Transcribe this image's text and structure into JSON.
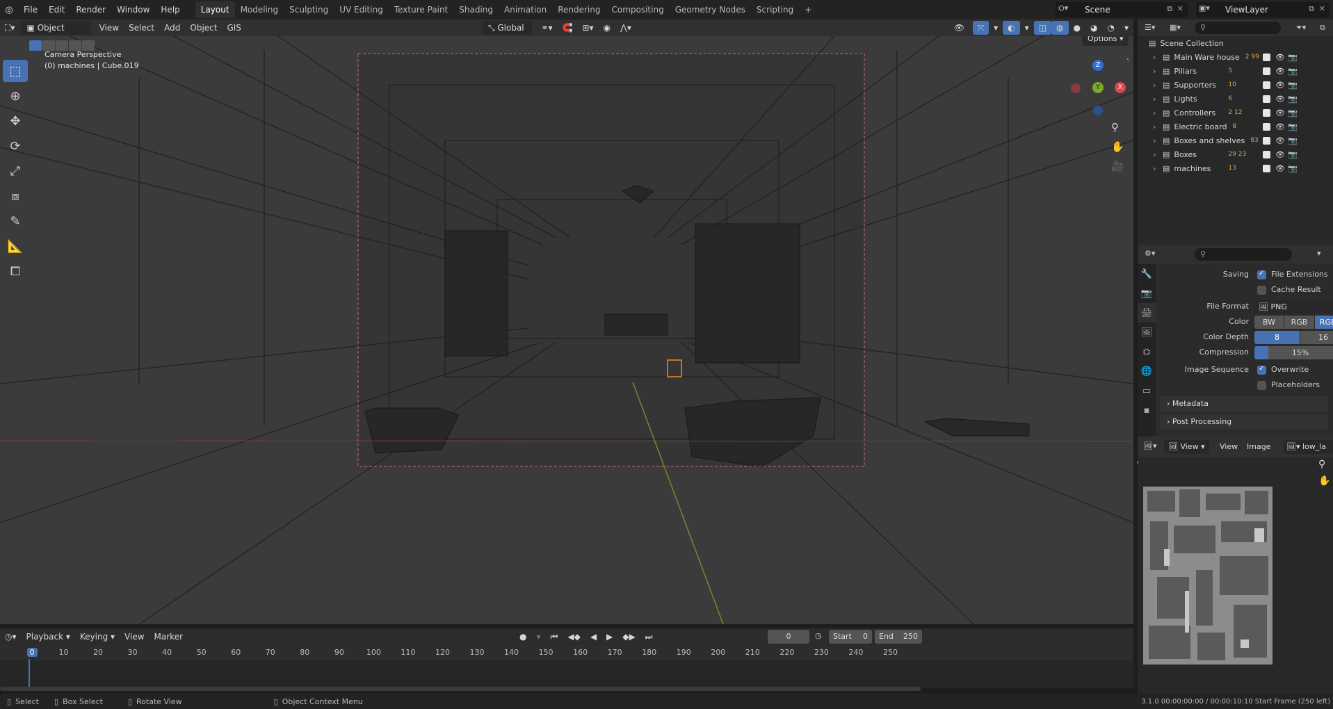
{
  "topbar": {
    "menus": [
      "File",
      "Edit",
      "Render",
      "Window",
      "Help"
    ],
    "workspaces": [
      "Layout",
      "Modeling",
      "Sculpting",
      "UV Editing",
      "Texture Paint",
      "Shading",
      "Animation",
      "Rendering",
      "Compositing",
      "Geometry Nodes",
      "Scripting"
    ],
    "active_workspace": "Layout",
    "add_tab": "+",
    "scene": "Scene",
    "view_layer": "ViewLayer"
  },
  "viewport_header": {
    "mode": "Object Mode",
    "menus": [
      "View",
      "Select",
      "Add",
      "Object",
      "GIS"
    ],
    "orientation": "Global",
    "options": "Options"
  },
  "viewport": {
    "camera_label": "Camera Perspective",
    "object_label": "(0) machines | Cube.019",
    "gizmo_z": "Z",
    "gizmo_y": "Y",
    "gizmo_x": "X"
  },
  "outliner": {
    "root": "Scene Collection",
    "items": [
      {
        "label": "Main Ware house",
        "badges": "2 99"
      },
      {
        "label": "Pillars",
        "badges": "5"
      },
      {
        "label": "Supporters",
        "badges": "10"
      },
      {
        "label": "Lights",
        "badges": "6"
      },
      {
        "label": "Controllers",
        "badges": "2 12"
      },
      {
        "label": "Electric board",
        "badges": "6"
      },
      {
        "label": "Boxes and shelves",
        "badges": "83"
      },
      {
        "label": "Boxes",
        "badges": "29 23"
      },
      {
        "label": "machines",
        "badges": "13"
      }
    ]
  },
  "properties": {
    "saving_label": "Saving",
    "file_extensions": "File Extensions",
    "cache_result": "Cache Result",
    "file_format_label": "File Format",
    "file_format": "PNG",
    "color_label": "Color",
    "color_options": [
      "BW",
      "RGB",
      "RGBA"
    ],
    "color_active": "RGBA",
    "color_depth_label": "Color Depth",
    "color_depth_options": [
      "8",
      "16"
    ],
    "compression_label": "Compression",
    "compression": "15%",
    "compression_fraction": 0.15,
    "image_sequence_label": "Image Sequence",
    "overwrite": "Overwrite",
    "placeholders": "Placeholders",
    "metadata": "Metadata",
    "post_processing": "Post Processing"
  },
  "image_editor": {
    "view_menu": "View",
    "view": "View",
    "image": "Image",
    "image_name": "low_la"
  },
  "timeline": {
    "menus": [
      "Playback",
      "Keying",
      "View",
      "Marker"
    ],
    "current_frame": "0",
    "start_label": "Start",
    "start": "0",
    "end_label": "End",
    "end": "250",
    "ticks": [
      "0",
      "10",
      "20",
      "30",
      "40",
      "50",
      "60",
      "70",
      "80",
      "90",
      "100",
      "110",
      "120",
      "130",
      "140",
      "150",
      "160",
      "170",
      "180",
      "190",
      "200",
      "210",
      "220",
      "230",
      "240",
      "250"
    ]
  },
  "statusbar": {
    "select": "Select",
    "box_select": "Box Select",
    "rotate_view": "Rotate View",
    "context_menu": "Object Context Menu",
    "info": "3.1.0   00:00:00:00 / 00:00:10:10   Start Frame (250 left)"
  }
}
